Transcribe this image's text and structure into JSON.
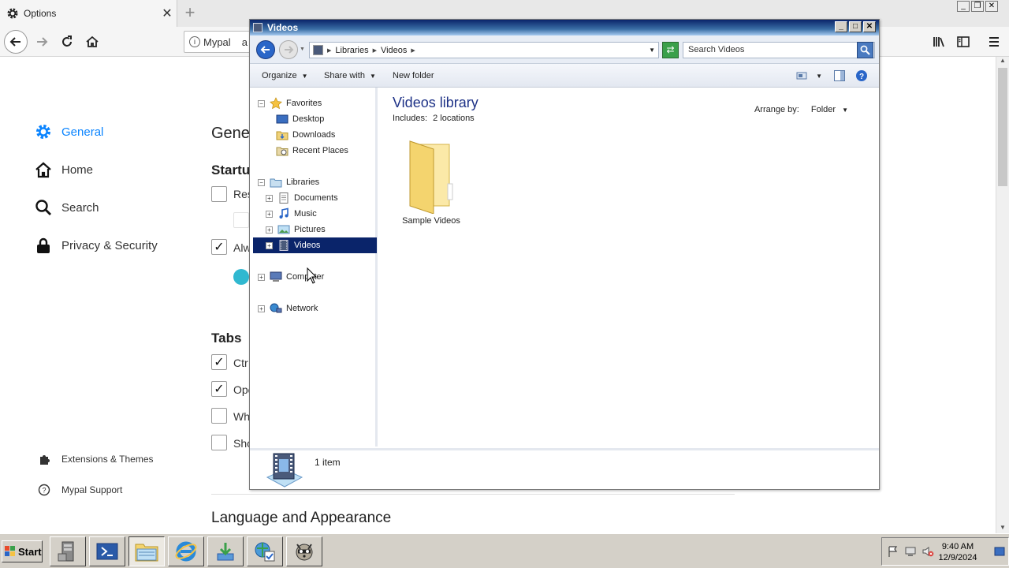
{
  "browser": {
    "tab_title": "Options",
    "url_text": "Mypal",
    "url_extra": "a",
    "colors": {
      "accent": "#0a84ff"
    }
  },
  "options": {
    "sidebar": [
      {
        "label": "General",
        "icon": "gear-icon",
        "active": true
      },
      {
        "label": "Home",
        "icon": "home-icon"
      },
      {
        "label": "Search",
        "icon": "search-icon"
      },
      {
        "label": "Privacy & Security",
        "icon": "lock-icon"
      }
    ],
    "footer_links": [
      {
        "label": "Extensions & Themes",
        "icon": "puzzle-icon"
      },
      {
        "label": "Mypal Support",
        "icon": "help-icon"
      }
    ],
    "page_title": "Gener",
    "startup_heading": "Startu",
    "startup_items": [
      {
        "label": "Res",
        "checked": false
      },
      {
        "label": "Alw",
        "checked": true
      }
    ],
    "tabs_heading": "Tabs",
    "tabs_items": [
      {
        "label": "Ctr",
        "checked": true
      },
      {
        "label": "Ope",
        "checked": true
      },
      {
        "label": "Wh",
        "checked": false
      },
      {
        "label": "Sho",
        "checked": false
      }
    ],
    "language_heading": "Language and Appearance"
  },
  "explorer": {
    "title": "Videos",
    "address": {
      "root": "Libraries",
      "current": "Videos"
    },
    "search_placeholder": "Search Videos",
    "toolbar": {
      "organize": "Organize",
      "share_with": "Share with",
      "new_folder": "New folder"
    },
    "tree": {
      "favorites": {
        "label": "Favorites",
        "children": [
          "Desktop",
          "Downloads",
          "Recent Places"
        ]
      },
      "libraries": {
        "label": "Libraries",
        "children": [
          "Documents",
          "Music",
          "Pictures",
          "Videos"
        ]
      },
      "computer": "Computer",
      "network": "Network",
      "selected": "Videos"
    },
    "content": {
      "title": "Videos library",
      "includes_label": "Includes:",
      "includes_link": "2 locations",
      "arrange_label": "Arrange by:",
      "arrange_value": "Folder",
      "items": [
        {
          "name": "Sample Videos",
          "icon": "folder-icon"
        }
      ]
    },
    "status": "1 item"
  },
  "taskbar": {
    "start_label": "Start",
    "buttons": [
      "server-manager-icon",
      "powershell-icon",
      "explorer-icon",
      "internet-explorer-icon",
      "download-icon",
      "globe-check-icon",
      "raccoon-app-icon"
    ],
    "clock_time": "9:40 AM",
    "clock_date": "12/9/2024"
  }
}
